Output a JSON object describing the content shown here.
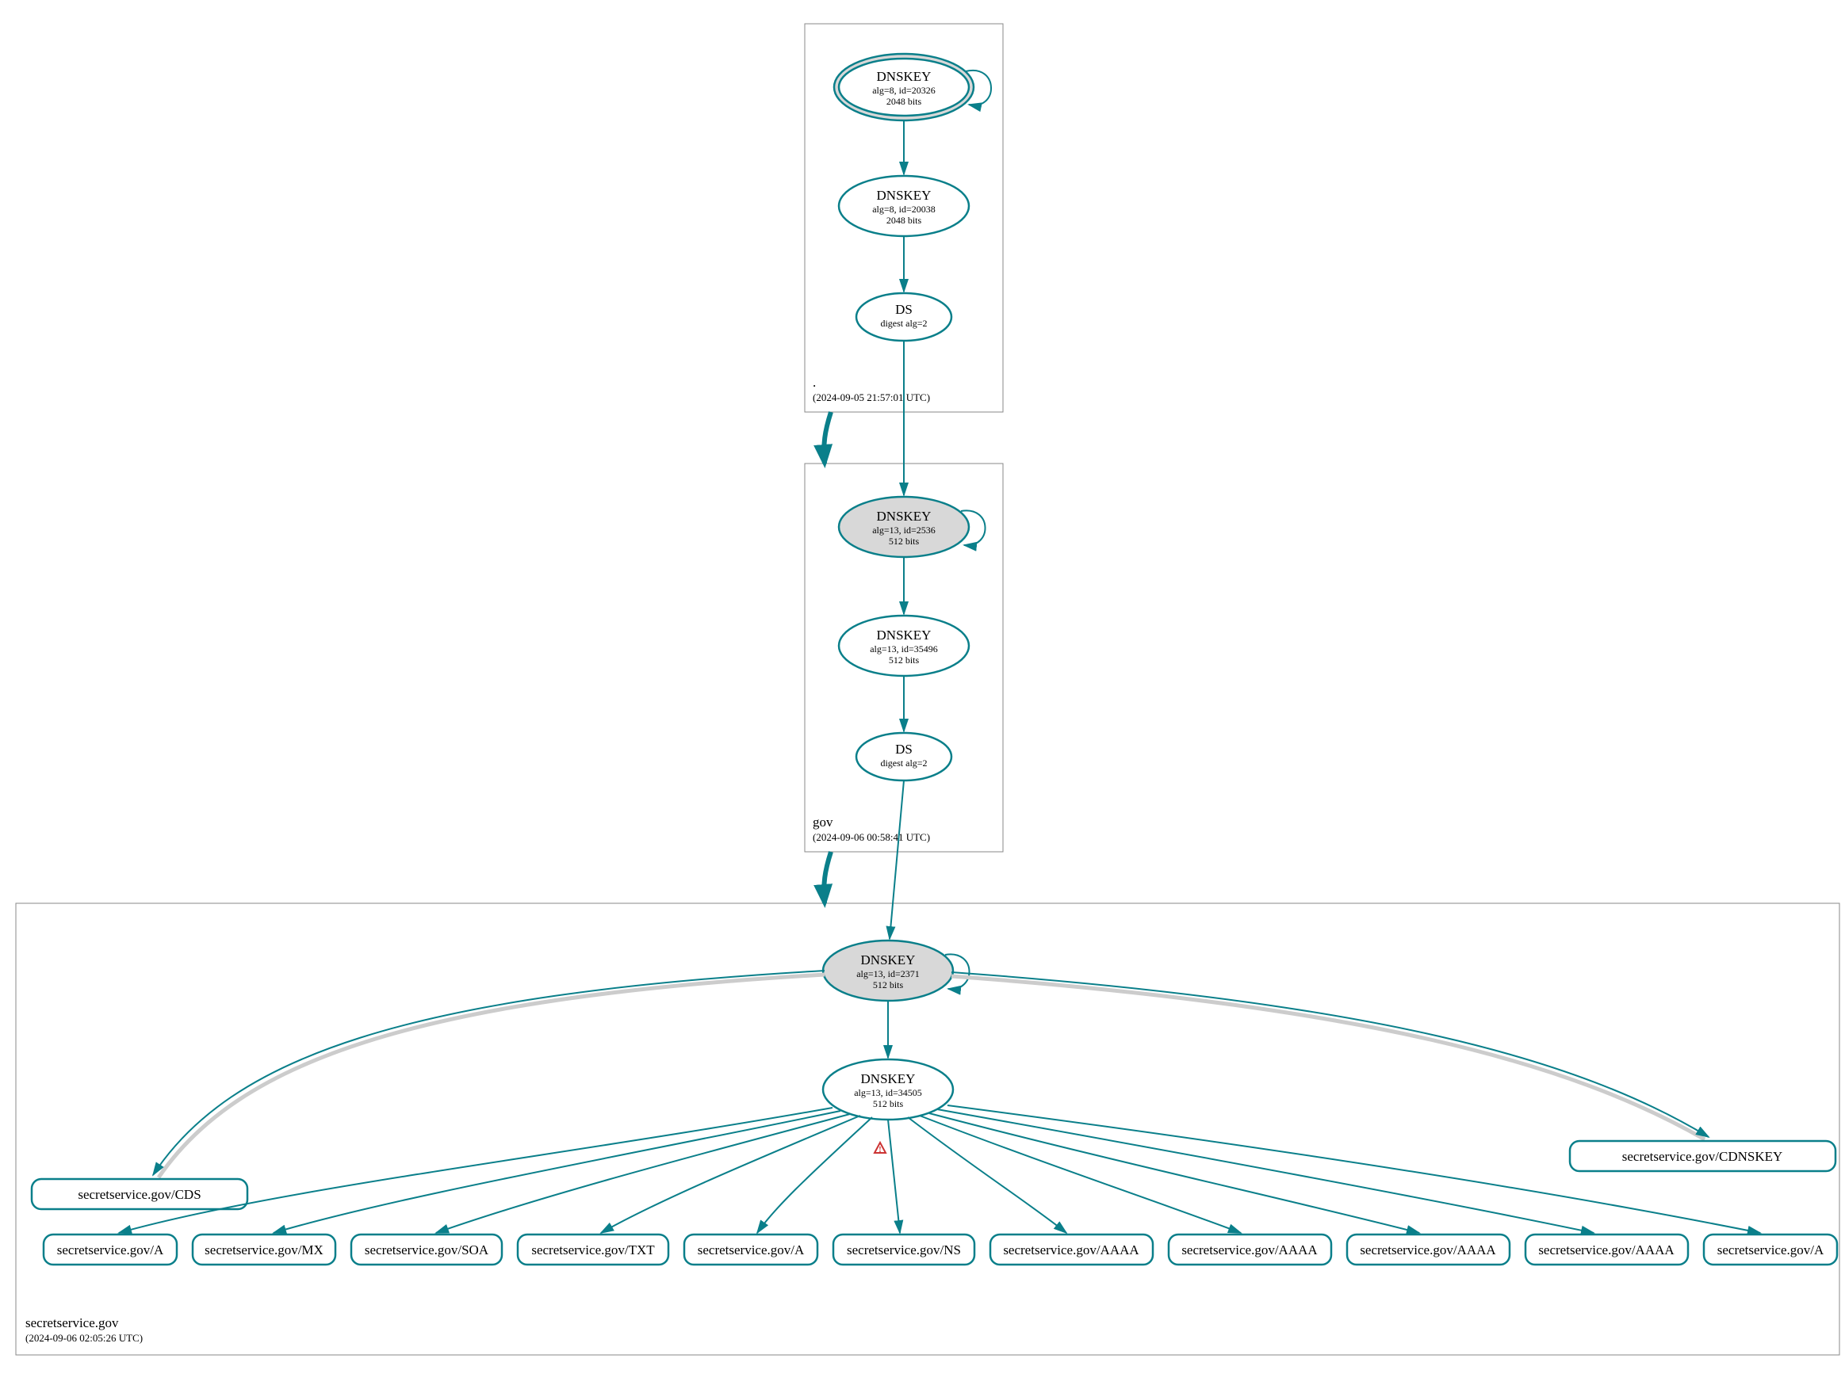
{
  "zones": {
    "root": {
      "label": ".",
      "timestamp": "(2024-09-05 21:57:01 UTC)"
    },
    "gov": {
      "label": "gov",
      "timestamp": "(2024-09-06 00:58:41 UTC)"
    },
    "secretservice": {
      "label": "secretservice.gov",
      "timestamp": "(2024-09-06 02:05:26 UTC)"
    }
  },
  "nodes": {
    "root_ksk": {
      "title": "DNSKEY",
      "line2": "alg=8, id=20326",
      "line3": "2048 bits"
    },
    "root_zsk": {
      "title": "DNSKEY",
      "line2": "alg=8, id=20038",
      "line3": "2048 bits"
    },
    "root_ds": {
      "title": "DS",
      "line2": "digest alg=2"
    },
    "gov_ksk": {
      "title": "DNSKEY",
      "line2": "alg=13, id=2536",
      "line3": "512 bits"
    },
    "gov_zsk": {
      "title": "DNSKEY",
      "line2": "alg=13, id=35496",
      "line3": "512 bits"
    },
    "gov_ds": {
      "title": "DS",
      "line2": "digest alg=2"
    },
    "ss_ksk": {
      "title": "DNSKEY",
      "line2": "alg=13, id=2371",
      "line3": "512 bits"
    },
    "ss_zsk": {
      "title": "DNSKEY",
      "line2": "alg=13, id=34505",
      "line3": "512 bits"
    }
  },
  "rrsets": {
    "cds": "secretservice.gov/CDS",
    "cdnskey": "secretservice.gov/CDNSKEY",
    "a1": "secretservice.gov/A",
    "mx": "secretservice.gov/MX",
    "soa": "secretservice.gov/SOA",
    "txt": "secretservice.gov/TXT",
    "a2": "secretservice.gov/A",
    "ns": "secretservice.gov/NS",
    "aaaa1": "secretservice.gov/AAAA",
    "aaaa2": "secretservice.gov/AAAA",
    "aaaa3": "secretservice.gov/AAAA",
    "aaaa4": "secretservice.gov/AAAA",
    "a3": "secretservice.gov/A"
  },
  "colors": {
    "teal": "#0a7f8a",
    "grey_fill": "#d8d8d8",
    "light_edge": "#cccccc",
    "warn": "#cc3333"
  }
}
